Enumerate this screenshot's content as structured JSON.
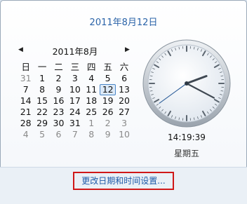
{
  "header": {
    "full_date": "2011年8月12日"
  },
  "calendar": {
    "month_label": "2011年8月",
    "prev_glyph": "◀",
    "next_glyph": "▶",
    "weekdays": [
      "日",
      "一",
      "二",
      "三",
      "四",
      "五",
      "六"
    ],
    "weeks": [
      [
        "31",
        "1",
        "2",
        "3",
        "4",
        "5",
        "6"
      ],
      [
        "7",
        "8",
        "9",
        "10",
        "11",
        "12",
        "13"
      ],
      [
        "14",
        "15",
        "16",
        "17",
        "18",
        "19",
        "20"
      ],
      [
        "21",
        "22",
        "23",
        "24",
        "25",
        "26",
        "27"
      ],
      [
        "28",
        "29",
        "30",
        "31",
        "1",
        "2",
        "3"
      ],
      [
        "4",
        "5",
        "6",
        "7",
        "8",
        "9",
        "10"
      ]
    ],
    "selected_day": "12"
  },
  "clock": {
    "time": "14:19:39",
    "weekday": "星期五"
  },
  "footer": {
    "change_link": "更改日期和时间设置..."
  },
  "colors": {
    "accent": "#2a63a8",
    "highlight_border": "#d01818"
  }
}
